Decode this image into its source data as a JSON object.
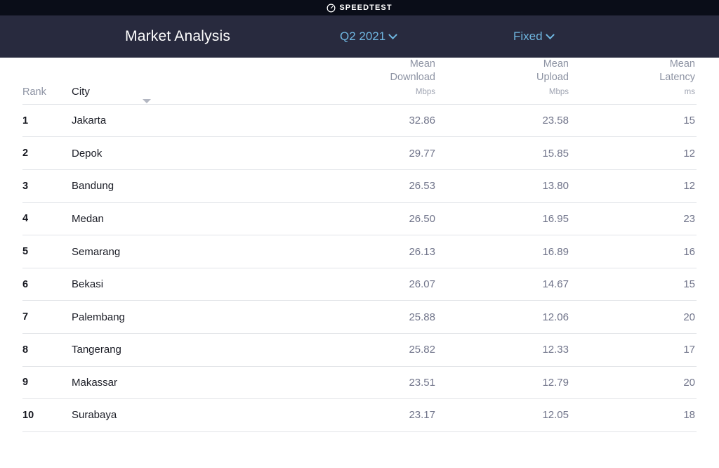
{
  "brandbar": {
    "logo_icon": "speedometer-icon",
    "name": "SPEEDTEST"
  },
  "navbar": {
    "title": "Market Analysis",
    "period_dropdown": {
      "label": "Q2 2021",
      "icon": "chevron-down-icon"
    },
    "type_dropdown": {
      "label": "Fixed",
      "icon": "chevron-down-icon"
    },
    "accent_color": "#6fb6e0",
    "background_color": "#282a3e"
  },
  "table": {
    "headers": {
      "rank": "Rank",
      "city": "City",
      "download_line1": "Mean",
      "download_line2": "Download",
      "download_unit": "Mbps",
      "upload_line1": "Mean",
      "upload_line2": "Upload",
      "upload_unit": "Mbps",
      "latency_line1": "Mean",
      "latency_line2": "Latency",
      "latency_unit": "ms"
    },
    "sort_column": "City",
    "sort_direction": "descending",
    "rows": [
      {
        "rank": "1",
        "city": "Jakarta",
        "download": "32.86",
        "upload": "23.58",
        "latency": "15"
      },
      {
        "rank": "2",
        "city": "Depok",
        "download": "29.77",
        "upload": "15.85",
        "latency": "12"
      },
      {
        "rank": "3",
        "city": "Bandung",
        "download": "26.53",
        "upload": "13.80",
        "latency": "12"
      },
      {
        "rank": "4",
        "city": "Medan",
        "download": "26.50",
        "upload": "16.95",
        "latency": "23"
      },
      {
        "rank": "5",
        "city": "Semarang",
        "download": "26.13",
        "upload": "16.89",
        "latency": "16"
      },
      {
        "rank": "6",
        "city": "Bekasi",
        "download": "26.07",
        "upload": "14.67",
        "latency": "15"
      },
      {
        "rank": "7",
        "city": "Palembang",
        "download": "25.88",
        "upload": "12.06",
        "latency": "20"
      },
      {
        "rank": "8",
        "city": "Tangerang",
        "download": "25.82",
        "upload": "12.33",
        "latency": "17"
      },
      {
        "rank": "9",
        "city": "Makassar",
        "download": "23.51",
        "upload": "12.79",
        "latency": "20"
      },
      {
        "rank": "10",
        "city": "Surabaya",
        "download": "23.17",
        "upload": "12.05",
        "latency": "18"
      }
    ]
  }
}
